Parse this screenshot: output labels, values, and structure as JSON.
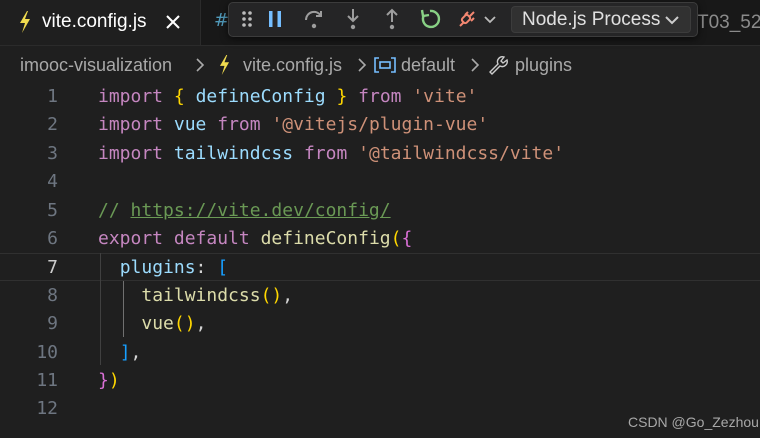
{
  "colors": {
    "keyword": "#c586c0",
    "storage": "#569cd6",
    "variable": "#9cdcfe",
    "function": "#dcdcaa",
    "string": "#ce9178",
    "comment": "#6a9955",
    "plain": "#d4d4d4",
    "bracket_gold": "#ffd700",
    "bracket_purple": "#da70d6",
    "bracket_blue": "#179fff",
    "js_icon": "#f0db4f"
  },
  "tabs": {
    "active": {
      "label": "vite.config.js",
      "icon": "lightning-bolt-icon"
    },
    "next_icon": "#",
    "right_label": "T03_52"
  },
  "debug_toolbar": {
    "icons": [
      "drag-handle-icon",
      "pause-icon",
      "step-over-icon",
      "step-into-icon",
      "step-out-icon",
      "restart-icon",
      "disconnect-icon"
    ],
    "process_label": "Node.js Process"
  },
  "breadcrumb": {
    "folder": "imooc-visualization",
    "file": "vite.config.js",
    "symbol": "default",
    "property": "plugins"
  },
  "editor": {
    "current_line": 7,
    "line_numbers": [
      "1",
      "2",
      "3",
      "4",
      "5",
      "6",
      "7",
      "8",
      "9",
      "10",
      "11",
      "12"
    ],
    "lines": [
      [
        [
          "import",
          "keyword"
        ],
        [
          " ",
          "plain"
        ],
        [
          "{",
          "bracket_gold"
        ],
        [
          " ",
          "plain"
        ],
        [
          "defineConfig",
          "variable"
        ],
        [
          " ",
          "plain"
        ],
        [
          "}",
          "bracket_gold"
        ],
        [
          " ",
          "plain"
        ],
        [
          "from",
          "keyword"
        ],
        [
          " ",
          "plain"
        ],
        [
          "'vite'",
          "string"
        ]
      ],
      [
        [
          "import",
          "keyword"
        ],
        [
          " ",
          "plain"
        ],
        [
          "vue",
          "variable"
        ],
        [
          " ",
          "plain"
        ],
        [
          "from",
          "keyword"
        ],
        [
          " ",
          "plain"
        ],
        [
          "'@vitejs/plugin-vue'",
          "string"
        ]
      ],
      [
        [
          "import",
          "keyword"
        ],
        [
          " ",
          "plain"
        ],
        [
          "tailwindcss",
          "variable"
        ],
        [
          " ",
          "plain"
        ],
        [
          "from",
          "keyword"
        ],
        [
          " ",
          "plain"
        ],
        [
          "'@tailwindcss/vite'",
          "string"
        ]
      ],
      [],
      [
        [
          "// ",
          "comment"
        ],
        [
          "https://vite.dev/config/",
          "comment_link"
        ]
      ],
      [
        [
          "export",
          "keyword"
        ],
        [
          " ",
          "plain"
        ],
        [
          "default",
          "keyword"
        ],
        [
          " ",
          "plain"
        ],
        [
          "defineConfig",
          "function"
        ],
        [
          "(",
          "bracket_gold"
        ],
        [
          "{",
          "bracket_purple"
        ]
      ],
      [
        [
          "  ",
          "plain"
        ],
        [
          "plugins",
          "variable"
        ],
        [
          ": ",
          "plain"
        ],
        [
          "[",
          "bracket_blue"
        ]
      ],
      [
        [
          "    ",
          "plain"
        ],
        [
          "tailwindcss",
          "function"
        ],
        [
          "()",
          "bracket_gold"
        ],
        [
          ",",
          "plain"
        ]
      ],
      [
        [
          "    ",
          "plain"
        ],
        [
          "vue",
          "function"
        ],
        [
          "()",
          "bracket_gold"
        ],
        [
          ",",
          "plain"
        ]
      ],
      [
        [
          "  ",
          "plain"
        ],
        [
          "]",
          "bracket_blue"
        ],
        [
          ",",
          "plain"
        ]
      ],
      [
        [
          "}",
          "bracket_purple"
        ],
        [
          ")",
          "bracket_gold"
        ]
      ],
      []
    ]
  },
  "watermark": "CSDN @Go_Zezhou"
}
